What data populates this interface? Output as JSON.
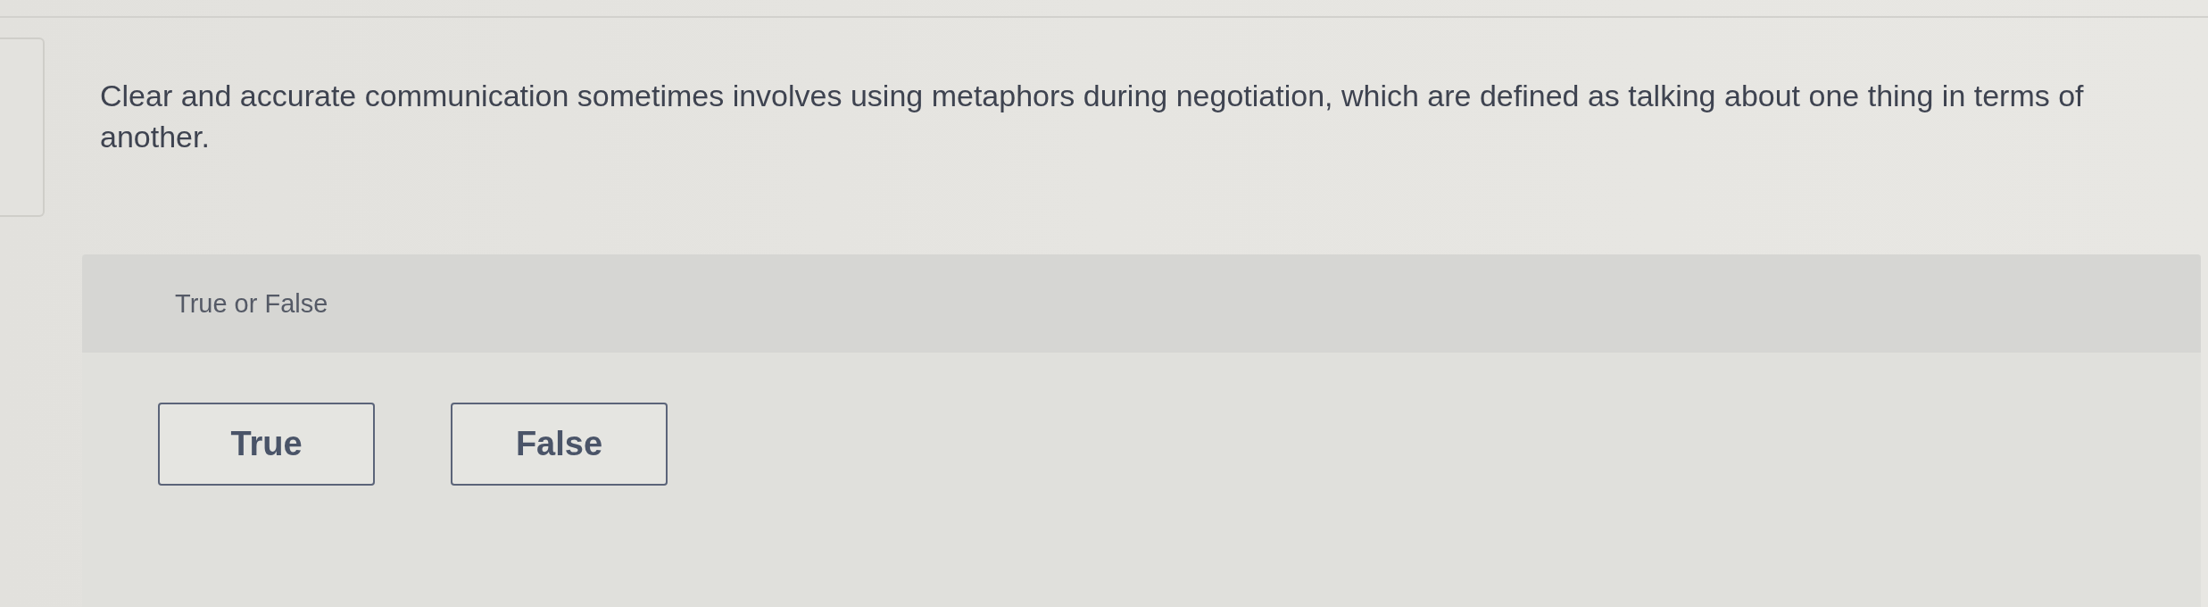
{
  "question": {
    "text": "Clear and accurate communication sometimes involves using metaphors during negotiation, which are defined as talking about one thing in terms of another."
  },
  "answer_panel": {
    "prompt": "True or False",
    "choices": [
      {
        "label": "True",
        "selected": false
      },
      {
        "label": "False",
        "selected": false
      }
    ]
  }
}
